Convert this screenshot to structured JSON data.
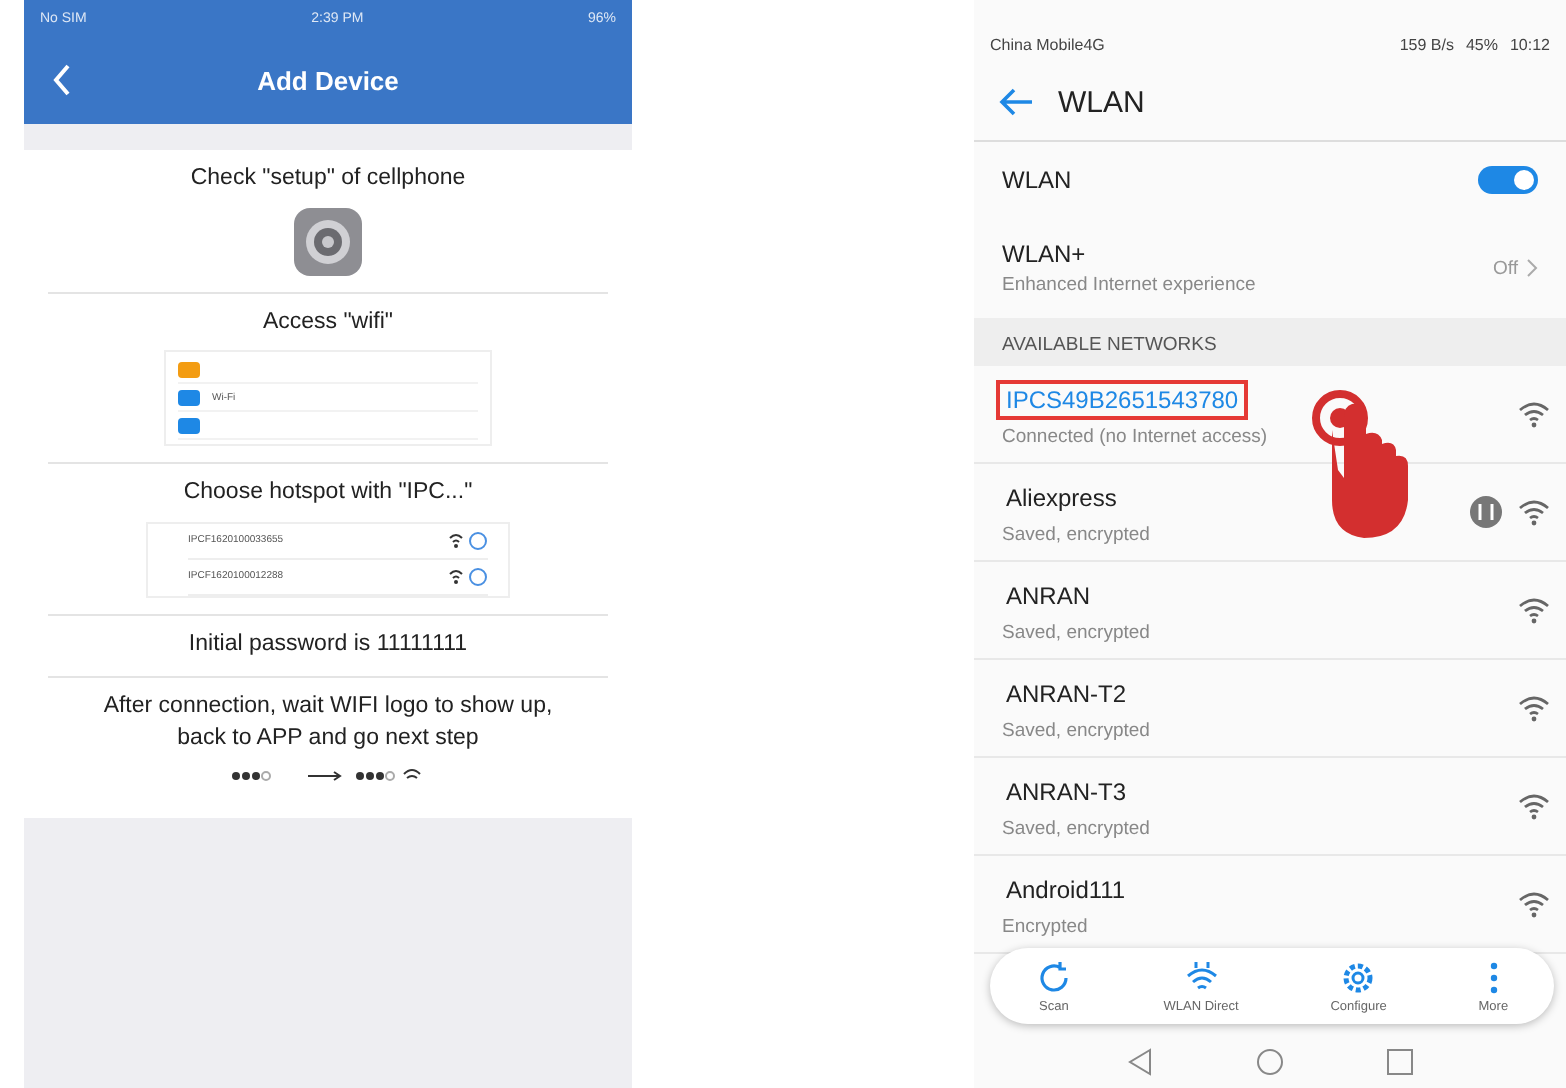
{
  "ios_screen": {
    "status_bar": {
      "carrier": "No SIM",
      "time": "2:39 PM",
      "battery": "96%"
    },
    "title": "Add Device",
    "steps": [
      {
        "kind": "settings",
        "text": "Check \"setup\" of cellphone"
      },
      {
        "kind": "wifi_menu",
        "text": "Access \"wifi\"",
        "menu_label": "Wi-Fi"
      },
      {
        "kind": "hotspots",
        "text": "Choose hotspot with \"IPC...\"",
        "hotspots": [
          "IPCF1620100033655",
          "IPCF1620100012288"
        ]
      },
      {
        "kind": "plain",
        "text": "Initial password is 11111111"
      },
      {
        "kind": "signal",
        "text": "After connection, wait WIFI logo to show up, back to APP and go next step"
      }
    ]
  },
  "android_screen": {
    "status_bar": {
      "carrier": "China Mobile4G",
      "speed": "159 B/s",
      "battery": "45%",
      "time": "10:12"
    },
    "title": "WLAN",
    "wlan": {
      "label": "WLAN",
      "on": true
    },
    "wlan_plus": {
      "label": "WLAN+",
      "description": "Enhanced Internet experience",
      "value": "Off"
    },
    "section_header": "AVAILABLE NETWORKS",
    "networks": [
      {
        "name": "IPCS49B2651543780",
        "status": "Connected (no Internet access)",
        "selected": true,
        "extra_badge": false
      },
      {
        "name": "Aliexpress",
        "status": "Saved, encrypted",
        "selected": false,
        "extra_badge": true
      },
      {
        "name": "ANRAN",
        "status": "Saved, encrypted",
        "selected": false,
        "extra_badge": false
      },
      {
        "name": "ANRAN-T2",
        "status": "Saved, encrypted",
        "selected": false,
        "extra_badge": false
      },
      {
        "name": "ANRAN-T3",
        "status": "Saved, encrypted",
        "selected": false,
        "extra_badge": false
      },
      {
        "name": "Android111",
        "status": "Encrypted",
        "selected": false,
        "extra_badge": false
      }
    ],
    "toolbar": [
      {
        "kind": "scan",
        "label": "Scan"
      },
      {
        "kind": "direct",
        "label": "WLAN Direct"
      },
      {
        "kind": "configure",
        "label": "Configure"
      },
      {
        "kind": "more",
        "label": "More"
      }
    ]
  }
}
